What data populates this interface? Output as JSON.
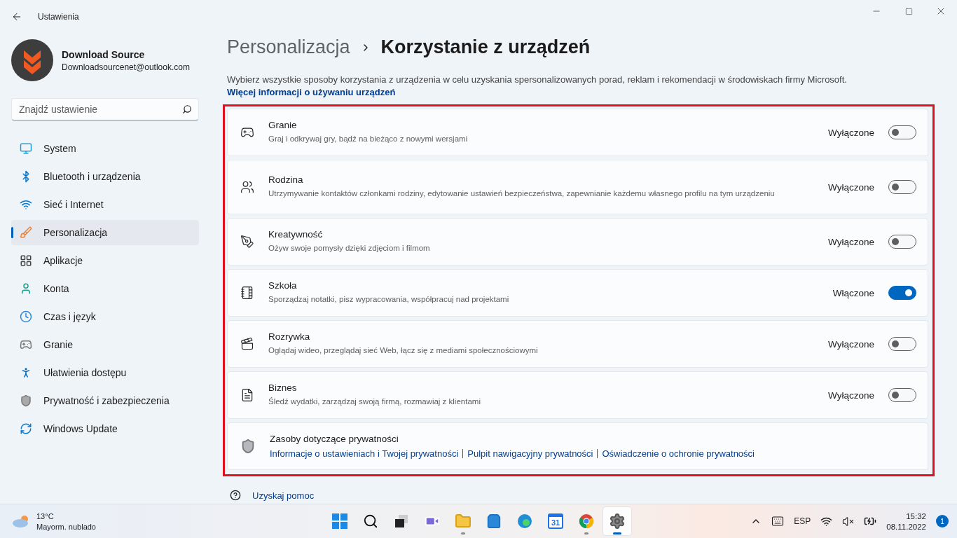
{
  "window": {
    "title": "Ustawienia"
  },
  "account": {
    "name": "Download Source",
    "email": "Downloadsourcenet@outlook.com"
  },
  "search": {
    "placeholder": "Znajdź ustawienie"
  },
  "nav": [
    {
      "kind": "system",
      "label": "System",
      "selected": false
    },
    {
      "kind": "bluetooth",
      "label": "Bluetooth i urządzenia",
      "selected": false
    },
    {
      "kind": "network",
      "label": "Sieć i Internet",
      "selected": false
    },
    {
      "kind": "brush",
      "label": "Personalizacja",
      "selected": true
    },
    {
      "kind": "apps",
      "label": "Aplikacje",
      "selected": false
    },
    {
      "kind": "account",
      "label": "Konta",
      "selected": false
    },
    {
      "kind": "time",
      "label": "Czas i język",
      "selected": false
    },
    {
      "kind": "gaming",
      "label": "Granie",
      "selected": false
    },
    {
      "kind": "accessibility",
      "label": "Ułatwienia dostępu",
      "selected": false
    },
    {
      "kind": "privacy",
      "label": "Prywatność i zabezpieczenia",
      "selected": false
    },
    {
      "kind": "update",
      "label": "Windows Update",
      "selected": false
    }
  ],
  "breadcrumb": {
    "parent": "Personalizacja",
    "current": "Korzystanie z urządzeń"
  },
  "intro": {
    "text": "Wybierz wszystkie sposoby korzystania z urządzenia w celu uzyskania spersonalizowanych porad, reklam i rekomendacji w środowiskach firmy Microsoft.",
    "link": "Więcej informacji o używaniu urządzeń"
  },
  "options": [
    {
      "kind": "gaming",
      "title": "Granie",
      "description": "Graj i odkrywaj gry, bądź na bieżąco z nowymi wersjami",
      "state": "Wyłączone",
      "on": false
    },
    {
      "kind": "family",
      "title": "Rodzina",
      "description": "Utrzymywanie kontaktów członkami rodziny, edytowanie ustawień bezpieczeństwa, zapewnianie każdemu własnego profilu na tym urządzeniu",
      "state": "Wyłączone",
      "on": false
    },
    {
      "kind": "creativity",
      "title": "Kreatywność",
      "description": "Ożyw swoje pomysły dzięki zdjęciom i filmom",
      "state": "Wyłączone",
      "on": false
    },
    {
      "kind": "school",
      "title": "Szkoła",
      "description": "Sporządzaj notatki, pisz wypracowania, współpracuj nad projektami",
      "state": "Włączone",
      "on": true
    },
    {
      "kind": "entertainment",
      "title": "Rozrywka",
      "description": "Oglądaj wideo, przeglądaj sieć Web, łącz się z mediami społecznościowymi",
      "state": "Wyłączone",
      "on": false
    },
    {
      "kind": "business",
      "title": "Biznes",
      "description": "Śledź wydatki, zarządzaj swoją firmą, rozmawiaj z klientami",
      "state": "Wyłączone",
      "on": false
    }
  ],
  "resources": {
    "title": "Zasoby dotyczące prywatności",
    "links": [
      "Informacje o ustawieniach i Twojej prywatności",
      "Pulpit nawigacyjny prywatności",
      "Oświadczenie o ochronie prywatności"
    ]
  },
  "help": {
    "label": "Uzyskaj pomoc"
  },
  "taskbar": {
    "weather": {
      "temperature": "13°C",
      "condition": "Mayorm. nublado"
    },
    "apps": [
      {
        "kind": "start",
        "running": false,
        "selected": false
      },
      {
        "kind": "search",
        "running": false,
        "selected": false
      },
      {
        "kind": "taskview",
        "running": false,
        "selected": false
      },
      {
        "kind": "chat",
        "running": false,
        "selected": false
      },
      {
        "kind": "explorer",
        "running": true,
        "selected": false
      },
      {
        "kind": "store",
        "running": false,
        "selected": false
      },
      {
        "kind": "edge",
        "running": false,
        "selected": false
      },
      {
        "kind": "calendar",
        "label": "31",
        "running": false,
        "selected": false
      },
      {
        "kind": "chrome",
        "running": true,
        "selected": false
      },
      {
        "kind": "settings",
        "running": true,
        "selected": true
      }
    ],
    "tray": {
      "language": "ESP",
      "time": "15:32",
      "date": "08.11.2022",
      "notifications": "1"
    }
  }
}
